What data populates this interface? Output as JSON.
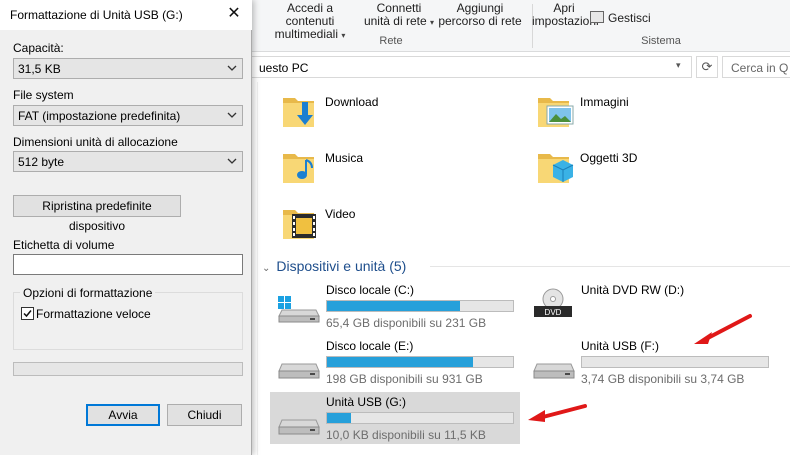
{
  "dialog": {
    "title": "Formattazione di Unità USB (G:)",
    "capacity_label": "Capacità:",
    "capacity_value": "31,5 KB",
    "filesystem_label": "File system",
    "filesystem_value": "FAT (impostazione predefinita)",
    "alloc_label": "Dimensioni unità di allocazione",
    "alloc_value": "512 byte",
    "restore_button": "Ripristina predefinite dispositivo",
    "volume_label_label": "Etichetta di volume",
    "volume_label_value": "",
    "options_group": "Opzioni di formattazione",
    "quick_format_label": "Formattazione veloce",
    "quick_format_checked": true,
    "progress": 0,
    "start_button": "Avvia",
    "close_button": "Chiudi"
  },
  "ribbon": {
    "rete_group": "Rete",
    "sistema_group": "Sistema",
    "buttons": [
      {
        "line1": "Accedi a contenuti",
        "line2": "multimediali"
      },
      {
        "line1": "Connetti",
        "line2": "unità di rete"
      },
      {
        "line1": "Aggiungi",
        "line2": "percorso di rete"
      },
      {
        "line1": "Apri",
        "line2": "impostazioni"
      }
    ],
    "manage_label": "Gestisci"
  },
  "address": {
    "path": "uesto PC",
    "search_placeholder": "Cerca in Q"
  },
  "folders": [
    {
      "label": "Download",
      "icon": "download-folder-icon"
    },
    {
      "label": "Immagini",
      "icon": "pictures-folder-icon"
    },
    {
      "label": "Musica",
      "icon": "music-folder-icon"
    },
    {
      "label": "Oggetti 3D",
      "icon": "3d-objects-folder-icon"
    },
    {
      "label": "Video",
      "icon": "video-folder-icon"
    }
  ],
  "devices": {
    "section_title": "Dispositivi e unità (5)",
    "drives": [
      {
        "name": "Disco locale (C:)",
        "free": "65,4 GB disponibili su 231 GB",
        "used_fraction": 0.717
      },
      {
        "name": "Unità DVD RW (D:)",
        "free": "",
        "used_fraction": null
      },
      {
        "name": "Disco locale (E:)",
        "free": "198 GB disponibili su 931 GB",
        "used_fraction": 0.787
      },
      {
        "name": "Unità USB (F:)",
        "free": "3,74 GB disponibili su 3,74 GB",
        "used_fraction": 0.0
      },
      {
        "name": "Unità USB (G:)",
        "free": "10,0 KB disponibili su 11,5 KB",
        "used_fraction": 0.13
      }
    ],
    "dvd_badge": "DVD"
  },
  "colors": {
    "bar_fill": "#26a0da",
    "arrow": "#e01818",
    "section_title": "#1e4e8c"
  }
}
